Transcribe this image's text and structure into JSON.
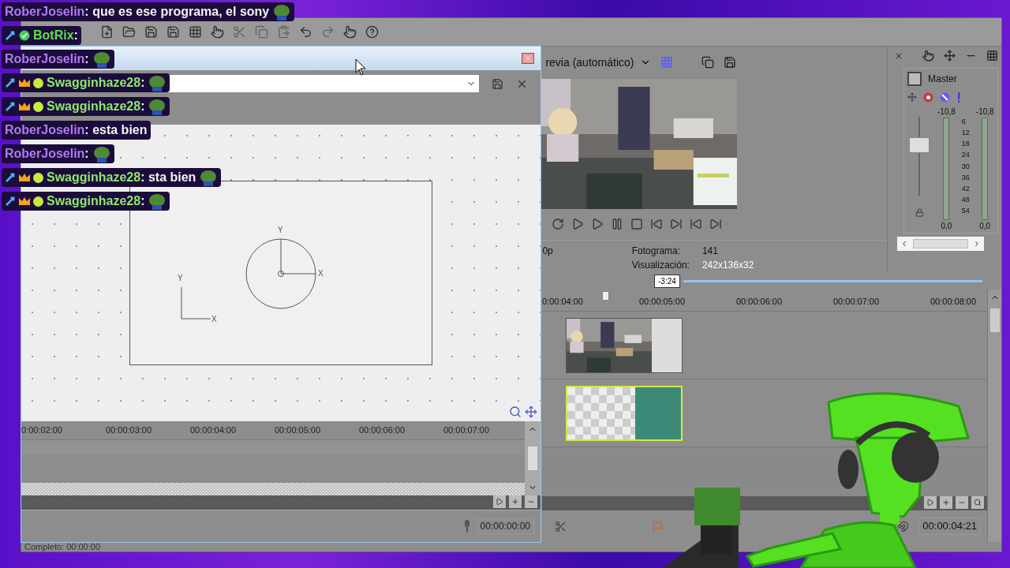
{
  "chat": [
    {
      "user": "RoberJoselin",
      "text": ": que es ese programa, el sony",
      "kind": "plain",
      "emote": true
    },
    {
      "user": "BotRix",
      "text": ":",
      "kind": "bot",
      "emote": false
    },
    {
      "user": "RoberJoselin",
      "text": ":",
      "kind": "plain",
      "emote": true
    },
    {
      "user": "Swagginhaze28",
      "text": ":",
      "kind": "vip",
      "emote": true
    },
    {
      "user": "Swagginhaze28",
      "text": ":",
      "kind": "vip",
      "emote": true
    },
    {
      "user": "RoberJoselin",
      "text": ": esta bien",
      "kind": "plain",
      "emote": false
    },
    {
      "user": "RoberJoselin",
      "text": ":",
      "kind": "plain",
      "emote": true
    },
    {
      "user": "Swagginhaze28",
      "text": ": sta bien",
      "kind": "vip",
      "emote": true
    },
    {
      "user": "Swagginhaze28",
      "text": ":",
      "kind": "vip",
      "emote": true
    }
  ],
  "dialog": {
    "canvas": {
      "axis_labels": [
        "Y",
        "X",
        "Y",
        "X"
      ]
    },
    "ruler": [
      "0:00:02:00",
      "00:00:03:00",
      "00:00:04:00",
      "00:00:05:00",
      "00:00:06:00",
      "00:00:07:00"
    ],
    "time": "00:00:00:00"
  },
  "preview": {
    "mode": "revia (automático)",
    "resolution": "0p",
    "info": [
      {
        "label": "Fotograma:",
        "value": "141"
      },
      {
        "label": "Visualización:",
        "value": "242x136x32"
      }
    ]
  },
  "mixer": {
    "title": "Master",
    "peaks": [
      "-10,8",
      "-10,8"
    ],
    "scale": [
      "6",
      "12",
      "18",
      "24",
      "30",
      "36",
      "42",
      "48",
      "54"
    ],
    "readings": [
      "0,0",
      "0,0"
    ]
  },
  "timeline": {
    "marker": "-3:24",
    "ruler": [
      "0:00:04:00",
      "00:00:05:00",
      "00:00:06:00",
      "00:00:07:00",
      "00:00:08:00"
    ],
    "time": "00:00:04:21"
  },
  "status": "Completo: 00:00:00"
}
